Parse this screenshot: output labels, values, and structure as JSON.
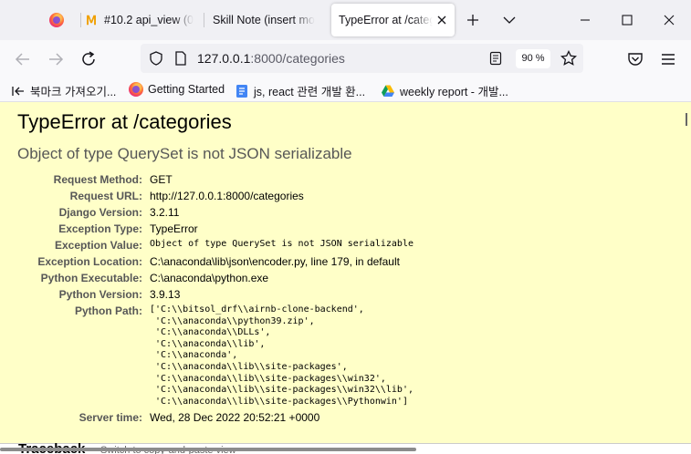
{
  "tabs": [
    {
      "title": "",
      "icon": "firefox-icon"
    },
    {
      "title": "#10.2 api_view (0",
      "icon": "m-logo-icon"
    },
    {
      "title": "Skill Note (insert mo",
      "icon": ""
    },
    {
      "title": "TypeError at /categ",
      "icon": ""
    }
  ],
  "address_bar": {
    "host": "127.0.0.1",
    "rest": ":8000/categories",
    "zoom": "90 %"
  },
  "bookmarks": [
    {
      "label": "북마크 가져오기...",
      "icon": "import-icon"
    },
    {
      "label": "Getting Started",
      "icon": "firefox-icon"
    },
    {
      "label": "js, react 관련 개발 환...",
      "icon": "docs-icon"
    },
    {
      "label": "weekly report - 개발...",
      "icon": "drive-icon"
    }
  ],
  "error": {
    "title": "TypeError at /categories",
    "subtitle": "Object of type QuerySet is not JSON serializable",
    "rows": [
      {
        "label": "Request Method:",
        "value": "GET"
      },
      {
        "label": "Request URL:",
        "value": "http://127.0.0.1:8000/categories"
      },
      {
        "label": "Django Version:",
        "value": "3.2.11"
      },
      {
        "label": "Exception Type:",
        "value": "TypeError"
      },
      {
        "label": "Exception Value:",
        "value": "Object of type QuerySet is not JSON serializable"
      },
      {
        "label": "Exception Location:",
        "value": "C:\\anaconda\\lib\\json\\encoder.py, line 179, in default"
      },
      {
        "label": "Python Executable:",
        "value": "C:\\anaconda\\python.exe"
      },
      {
        "label": "Python Version:",
        "value": "3.9.13"
      }
    ],
    "python_path_label": "Python Path:",
    "python_path": [
      "['C:\\\\bitsol_drf\\\\airnb-clone-backend',",
      " 'C:\\\\anaconda\\\\python39.zip',",
      " 'C:\\\\anaconda\\\\DLLs',",
      " 'C:\\\\anaconda\\\\lib',",
      " 'C:\\\\anaconda',",
      " 'C:\\\\anaconda\\\\lib\\\\site-packages',",
      " 'C:\\\\anaconda\\\\lib\\\\site-packages\\\\win32',",
      " 'C:\\\\anaconda\\\\lib\\\\site-packages\\\\win32\\\\lib',",
      " 'C:\\\\anaconda\\\\lib\\\\site-packages\\\\Pythonwin']"
    ],
    "server_time_label": "Server time:",
    "server_time": "Wed, 28 Dec 2022 20:52:21 +0000",
    "traceback_title": "Traceback",
    "traceback_hint": "Switch to copy-and-paste view"
  }
}
